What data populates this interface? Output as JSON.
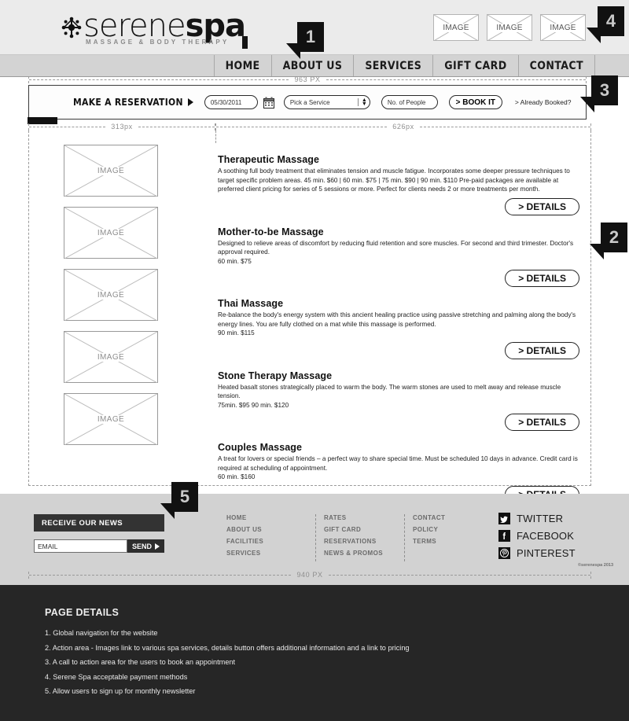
{
  "brand": {
    "name_light": "serene",
    "name_heavy": "spa",
    "tagline": "MASSAGE & BODY THERAPY",
    "logo_icon": "asterisk-flower-icon"
  },
  "header": {
    "payment_images": [
      "IMAGE",
      "IMAGE",
      "IMAGE"
    ]
  },
  "nav": {
    "items": [
      {
        "label": "HOME"
      },
      {
        "label": "ABOUT US"
      },
      {
        "label": "SERVICES"
      },
      {
        "label": "GIFT CARD"
      },
      {
        "label": "CONTACT"
      }
    ]
  },
  "callouts": [
    {
      "number": "1"
    },
    {
      "number": "2"
    },
    {
      "number": "3"
    },
    {
      "number": "4"
    },
    {
      "number": "5"
    }
  ],
  "measures": {
    "top_width": "963 PX",
    "left_col": "313px",
    "right_col": "626px",
    "footer_width": "940 PX"
  },
  "reservation": {
    "title": "MAKE A RESERVATION",
    "date_value": "05/30/2011",
    "calendar_icon": "calendar-icon",
    "service_placeholder": "Pick a Service",
    "people_placeholder": "No. of People",
    "book_label": "> BOOK IT",
    "already_booked": "> Already Booked?"
  },
  "services": {
    "image_label": "IMAGE",
    "details_label": "> DETAILS",
    "items": [
      {
        "title": "Therapeutic Massage",
        "description": "A soothing full body treatment that eliminates tension and muscle fatigue.  Incorporates some deeper pressure techniques to target specific problem areas.  45 min.  $60    |    60 min.  $75    |    75 min.  $90    |    90 min.  $110  Pre-paid packages are available at preferred client pricing for series of 5 sessions or more.  Perfect for clients needs 2 or more treatments per month."
      },
      {
        "title": "Mother-to-be Massage",
        "description": "Designed to relieve areas of discomfort by reducing fluid retention and sore muscles.  For second and third trimester. Doctor's approval required.",
        "pricing": "60 min.  $75"
      },
      {
        "title": "Thai Massage",
        "description": "Re-balance the body's energy system with this ancient healing practice using passive stretching and palming along the body's energy lines.  You are fully clothed on a mat while this massage is performed.",
        "pricing": "90 min.  $115"
      },
      {
        "title": "Stone Therapy Massage",
        "description": "Heated basalt stones strategically placed to warm the body.  The warm stones are used to melt away and release muscle tension.",
        "pricing": "75min.  $95  90 min.  $120"
      },
      {
        "title": "Couples Massage",
        "description": "A treat for lovers or special friends – a perfect way to share special time.    Must be scheduled 10 days in advance. Credit card is required at scheduling of appointment.",
        "pricing": "60 min.  $160"
      }
    ]
  },
  "newsletter": {
    "heading": "RECEIVE OUR NEWS",
    "input_placeholder": "EMAIL",
    "send_label": "SEND"
  },
  "footer": {
    "columns": [
      {
        "links": [
          "HOME",
          "ABOUT US",
          "FACILITIES",
          "SERVICES"
        ]
      },
      {
        "links": [
          "RATES",
          "GIFT CARD",
          "RESERVATIONS",
          "NEWS & PROMOS"
        ]
      },
      {
        "links": [
          "CONTACT",
          "POLICY",
          "TERMS"
        ]
      }
    ],
    "social": [
      {
        "label": "TWITTER",
        "icon": "twitter-icon"
      },
      {
        "label": "FACEBOOK",
        "icon": "facebook-icon"
      },
      {
        "label": "PINTEREST",
        "icon": "pinterest-icon"
      }
    ],
    "copyright": "©serenespa 2013"
  },
  "page_details": {
    "heading": "PAGE DETAILS",
    "items": [
      "1. Global navigation for the website",
      "2. Action area - Images link to various spa services, details button offers additional information and a link to pricing",
      "3. A call to action area for the users to book an appointment",
      "4. Serene Spa acceptable payment methods",
      "5. Allow users to sign up for monthly newsletter"
    ]
  }
}
